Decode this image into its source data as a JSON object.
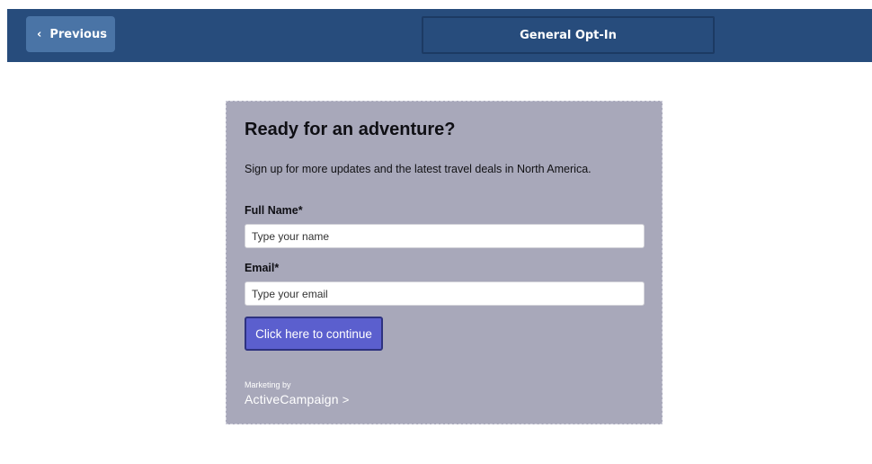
{
  "topbar": {
    "previous_label": "Previous",
    "title": "General Opt-In"
  },
  "form": {
    "heading": "Ready for an adventure?",
    "subtext": "Sign up for more updates and the latest travel deals in North America.",
    "fields": [
      {
        "label": "Full Name*",
        "placeholder": "Type your name",
        "value": ""
      },
      {
        "label": "Email*",
        "placeholder": "Type your email",
        "value": ""
      }
    ],
    "submit_label": "Click here to continue",
    "marketing_by": "Marketing by",
    "brand": "ActiveCampaign"
  },
  "colors": {
    "topbar": "#274c7c",
    "previous_button": "#4a74a6",
    "form_background": "#a8a8ba",
    "submit_button": "#5b5fce"
  }
}
